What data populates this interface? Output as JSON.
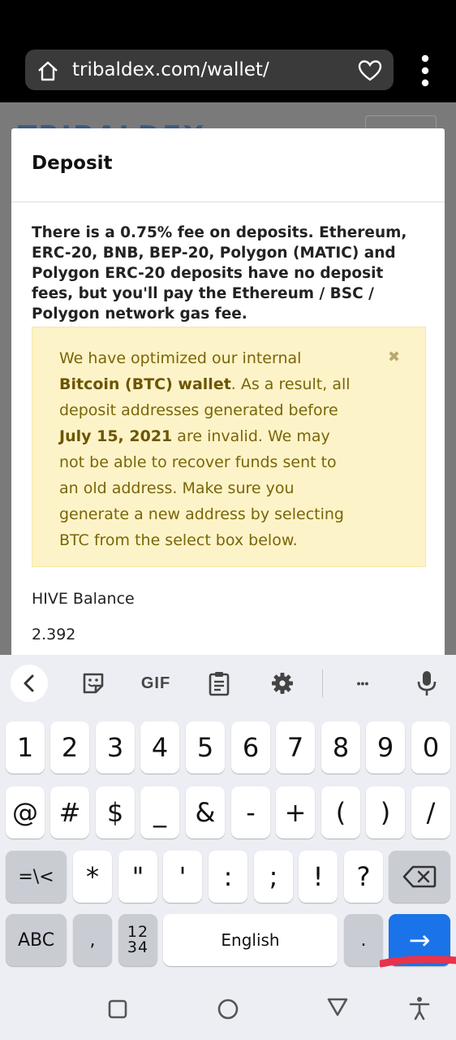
{
  "browser": {
    "url": "tribaldex.com/wallet/"
  },
  "background_page": {
    "logo_text": "TRIBALDEX"
  },
  "modal": {
    "title": "Deposit",
    "fee_notice": "There is a 0.75% fee on deposits. Ethereum, ERC-20, BNB, BEP-20, Polygon (MATIC) and Polygon ERC-20 deposits have no deposit fees, but you'll pay the Ethereum / BSC / Polygon network gas fee.",
    "alert": {
      "part1": "We have optimized our internal ",
      "bold1": "Bitcoin (BTC) wallet",
      "part2": ". As a result, all deposit addresses generated before ",
      "bold2": "July 15, 2021",
      "part3": " are invalid. We may not be able to recover funds sent to an old address. Make sure you generate a new address by selecting BTC from the select box below.",
      "close_symbol": "✖"
    },
    "balance_label": "HIVE Balance",
    "balance_value": "2.392"
  },
  "keyboard": {
    "toolbar": {
      "gif_label": "GIF",
      "more_label": "•••"
    },
    "row1": [
      "1",
      "2",
      "3",
      "4",
      "5",
      "6",
      "7",
      "8",
      "9",
      "0"
    ],
    "row2": [
      "@",
      "#",
      "$",
      "_",
      "&",
      "-",
      "+",
      "(",
      ")",
      "/"
    ],
    "row3_shift": "=\\<",
    "row3": [
      "*",
      "\"",
      "'",
      ":",
      ";",
      "!",
      "?"
    ],
    "row4": {
      "abc": "ABC",
      "comma": ",",
      "numpad_top": "12",
      "numpad_bottom": "34",
      "space": "English",
      "period": ".",
      "enter": "→"
    }
  },
  "colors": {
    "alert_bg": "#fdf3c8",
    "alert_text": "#7a6508",
    "enter_key": "#1a73e8",
    "swipe_mark": "#e8334a"
  }
}
